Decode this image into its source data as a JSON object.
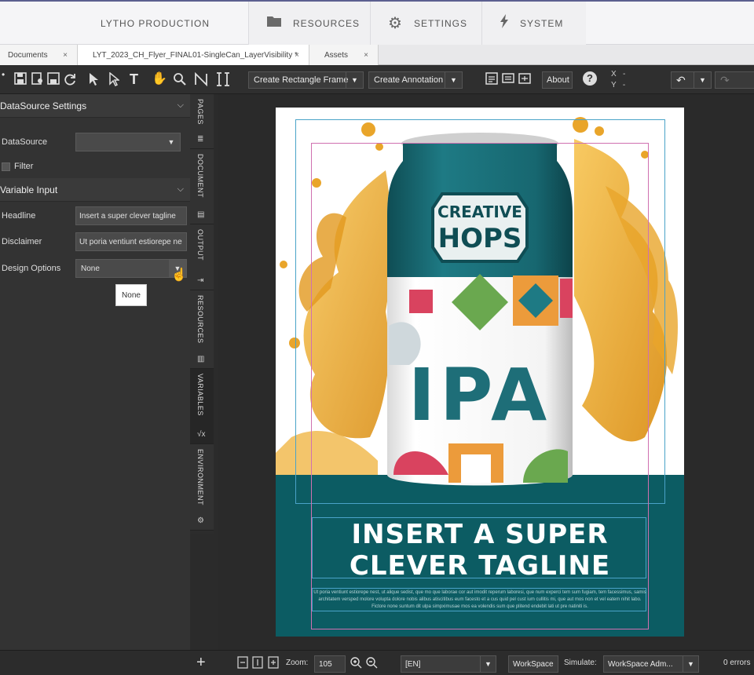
{
  "topnav": {
    "brand": "LYTHO PRODUCTION",
    "tabs": [
      {
        "label": "RESOURCES",
        "icon": "folder-icon"
      },
      {
        "label": "SETTINGS",
        "icon": "gear-icon"
      },
      {
        "label": "SYSTEM",
        "icon": "lightning-icon"
      }
    ]
  },
  "doctabs": [
    {
      "label": "Documents",
      "close": "×"
    },
    {
      "label": "LYT_2023_CH_Flyer_FINAL01-SingleCan_LayerVisibility *",
      "close": "×"
    },
    {
      "label": "Assets",
      "close": "×"
    }
  ],
  "toolbar": {
    "create_frame": "Create Rectangle Frame",
    "create_annotation": "Create Annotation",
    "about": "About",
    "x_label": "X",
    "y_label": "Y",
    "x_value": "-",
    "y_value": "-"
  },
  "leftpanel": {
    "datasource_header": "DataSource Settings",
    "datasource_label": "DataSource",
    "datasource_value": "",
    "filter_label": "Filter",
    "variable_header": "Variable Input",
    "fields": [
      {
        "label": "Headline",
        "value": "Insert a super clever tagline"
      },
      {
        "label": "Disclaimer",
        "value": "Ut poria ventiunt estiorepe ne"
      },
      {
        "label": "Design Options",
        "value": "None"
      }
    ],
    "tooltip": "None"
  },
  "vtabs": [
    "PAGES",
    "DOCUMENT",
    "OUTPUT",
    "RESOURCES",
    "VARIABLES",
    "ENVIRONMENT"
  ],
  "document": {
    "brand_line1": "CREATIVE",
    "brand_line2": "HOPS",
    "product": "IPA",
    "tagline_line1": "INSERT A SUPER",
    "tagline_line2": "CLEVER TAGLINE",
    "disclaimer": "Ut poria ventiunt estiorepe nest, ut alique sedist, que mo que laborae cor aut imodit reperum laboresi, que num experci tem sum fugiam, tem facessimus, samis architatem versped molore volupta dolore nobis alibus atiscitibus eum facesto et a cus quid pel cust ium cullitis mi, que aut mos non et vel eatem nihit labo. Fictore none suntum dit ulpa simpximusae mos ea volendis sum que plitend endebit lati ut pre natiniti is."
  },
  "bottombar": {
    "zoom_label": "Zoom:",
    "zoom_value": "105",
    "language": "[EN]",
    "workspace": "WorkSpace",
    "simulate_label": "Simulate:",
    "simulate_value": "WorkSpace Adm...",
    "errors": "0 errors"
  },
  "colors": {
    "teal": "#0c5c63",
    "can_teal": "#1e6e78",
    "beer": "#e8a21c"
  }
}
